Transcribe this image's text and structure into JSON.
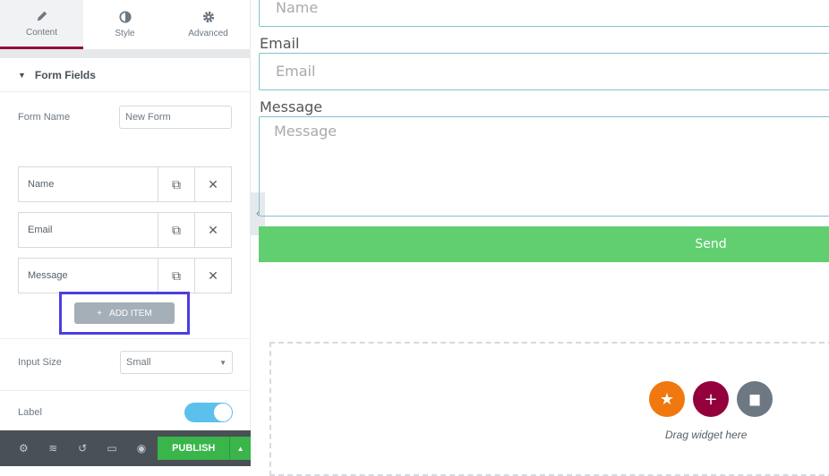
{
  "panel": {
    "tabs": [
      {
        "label": "Content",
        "icon": "pencil-icon"
      },
      {
        "label": "Style",
        "icon": "contrast-icon"
      },
      {
        "label": "Advanced",
        "icon": "gear-icon"
      }
    ],
    "section_title": "Form Fields",
    "form_name_label": "Form Name",
    "form_name_value": "New Form",
    "items": [
      {
        "label": "Name"
      },
      {
        "label": "Email"
      },
      {
        "label": "Message"
      }
    ],
    "add_item": "ADD ITEM",
    "input_size_label": "Input Size",
    "input_size_value": "Small",
    "label_toggle_label": "Label",
    "label_toggle_on": true,
    "publish": "PUBLISH"
  },
  "preview": {
    "name_placeholder": "Name",
    "email_label": "Email",
    "email_placeholder": "Email",
    "message_label": "Message",
    "message_placeholder": "Message",
    "send": "Send",
    "drag_text": "Drag widget here"
  },
  "colors": {
    "accent": "#93003c",
    "publish": "#39b54a",
    "send": "#61ce70",
    "highlight": "#4b3ee0",
    "star": "#f0780f",
    "add": "#93003c",
    "folder": "#6d7882"
  }
}
